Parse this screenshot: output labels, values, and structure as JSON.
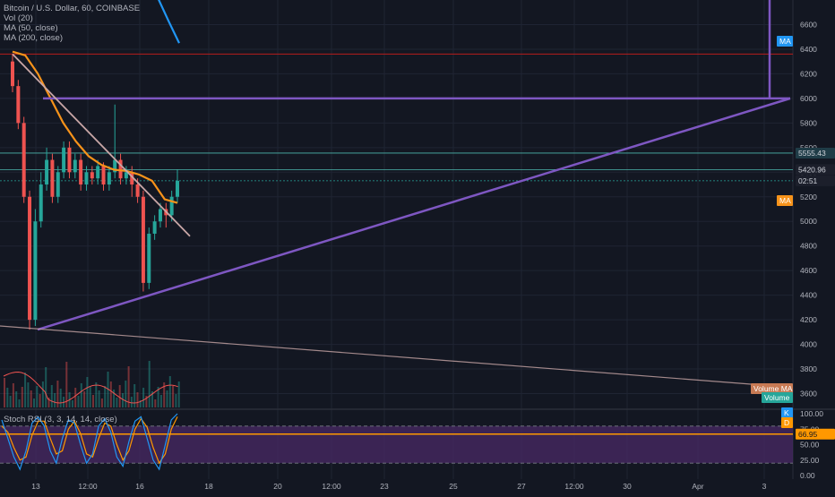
{
  "legend": {
    "title": "Bitcoin / U.S. Dollar, 60, COINBASE",
    "vol": "Vol (20)",
    "ma50": "MA (50, close)",
    "ma200": "MA (200, close)"
  },
  "stoch_legend": "Stoch RSI (3, 3, 14, 14, close)",
  "colors": {
    "background": "#131722",
    "grid": "#1f2433",
    "text": "#b2b5be",
    "up": "#26a69a",
    "down": "#ef5350",
    "ma50": "#f7931a",
    "ma200": "#2196f3",
    "trendline": "#7e57c2",
    "descending_line": "#c8a6a6",
    "red_hline": "#b71c1c",
    "stoch_band": "#4a2a66",
    "stoch_k": "#2196f3",
    "stoch_d": "#ff9800",
    "price_label": "#26a69a",
    "ma_tag": "#2196f3"
  },
  "chart_data": [
    {
      "type": "candlestick",
      "title": "Bitcoin / U.S. Dollar, 60, COINBASE",
      "ylim": [
        3480,
        6800
      ],
      "y_ticks": [
        3600,
        3800,
        4000,
        4200,
        4400,
        4600,
        4800,
        5000,
        5200,
        5400,
        5600,
        5800,
        6000,
        6200,
        6400,
        6600
      ],
      "x_ticks": [
        "13",
        "12:00",
        "16",
        "18",
        "20",
        "12:00",
        "23",
        "25",
        "27",
        "12:00",
        "30",
        "Apr",
        "3"
      ],
      "series": [
        {
          "name": "MA (50, close)",
          "values": [
            6380,
            6350,
            6200,
            6000,
            5800,
            5650,
            5530,
            5460,
            5420,
            5410,
            5380,
            5330,
            5180,
            5150
          ]
        },
        {
          "name": "MA (200, close)",
          "values": [
            6950,
            6800,
            6620,
            6450
          ]
        }
      ],
      "candles": {
        "open": [
          6300,
          6100,
          5800,
          5200,
          4200,
          5000,
          5300,
          5500,
          5200,
          5400,
          5600,
          5400,
          5500,
          5300,
          5400,
          5350,
          5450,
          5300,
          5400,
          5500,
          5350,
          5400,
          5300,
          5200,
          4500,
          4900,
          5000,
          5100,
          5050,
          5200
        ],
        "close": [
          6100,
          5800,
          5200,
          4200,
          5000,
          5300,
          5500,
          5200,
          5400,
          5600,
          5400,
          5500,
          5300,
          5400,
          5350,
          5450,
          5300,
          5400,
          5500,
          5350,
          5400,
          5300,
          5200,
          4500,
          4900,
          5000,
          5100,
          5050,
          5200,
          5330
        ],
        "high": [
          6360,
          6150,
          5850,
          5250,
          5100,
          5400,
          5600,
          5550,
          5450,
          5650,
          5650,
          5550,
          5550,
          5450,
          5450,
          5500,
          5480,
          5450,
          5950,
          5550,
          5450,
          5450,
          5350,
          5250,
          4950,
          5050,
          5150,
          5150,
          5250,
          5420
        ],
        "low": [
          6050,
          5750,
          5150,
          4120,
          4150,
          4950,
          5250,
          5150,
          5150,
          5350,
          5350,
          5350,
          5250,
          5250,
          5300,
          5300,
          5250,
          5250,
          5350,
          5300,
          5300,
          5200,
          5150,
          4430,
          4450,
          4850,
          4950,
          4950,
          5000,
          5150
        ]
      },
      "annotations": [
        {
          "label": "5555.43",
          "value": 5555.43,
          "kind": "horizontal-line"
        },
        {
          "label": "5420.96",
          "value": 5420.96,
          "kind": "horizontal-line"
        },
        {
          "label": "02:51",
          "kind": "countdown"
        },
        {
          "label": "6000",
          "value": 6000,
          "kind": "horizontal-line"
        },
        {
          "label": "6360",
          "value": 6360,
          "kind": "horizontal-line"
        },
        {
          "label": "MA",
          "kind": "indicator-tag"
        },
        {
          "label": "MA",
          "kind": "indicator-tag"
        }
      ],
      "trendlines": [
        {
          "name": "rising-support",
          "from": [
            4120,
            "13"
          ],
          "to": [
            6000,
            "3"
          ]
        },
        {
          "name": "descending-resistance",
          "from": [
            6360,
            "13"
          ],
          "to": [
            4880,
            "16"
          ]
        },
        {
          "name": "long-descending",
          "from": [
            4150,
            "12"
          ],
          "to": [
            3650,
            "3"
          ]
        }
      ]
    },
    {
      "type": "bar",
      "title": "Vol (20)",
      "labels": [
        "Volume MA",
        "Volume"
      ]
    },
    {
      "type": "line",
      "title": "Stoch RSI (3, 3, 14, 14, close)",
      "ylim": [
        0,
        100
      ],
      "y_ticks": [
        0,
        25,
        50,
        75,
        100
      ],
      "y_tick_labels": [
        "0.00",
        "25.00",
        "50.00",
        "75.00",
        "100.00"
      ],
      "band": [
        20,
        80
      ],
      "current_label": "66.95",
      "current_value": 66.95,
      "series_labels": [
        "K",
        "D"
      ],
      "k_values": [
        90,
        60,
        30,
        10,
        40,
        85,
        95,
        80,
        40,
        20,
        60,
        90,
        85,
        50,
        20,
        35,
        80,
        92,
        70,
        30,
        15,
        55,
        88,
        95,
        60,
        25,
        10,
        50,
        90,
        100
      ],
      "d_values": [
        80,
        70,
        45,
        25,
        30,
        65,
        88,
        88,
        60,
        35,
        40,
        75,
        88,
        68,
        35,
        30,
        60,
        85,
        80,
        50,
        25,
        40,
        75,
        92,
        78,
        45,
        20,
        35,
        75,
        95
      ]
    }
  ]
}
